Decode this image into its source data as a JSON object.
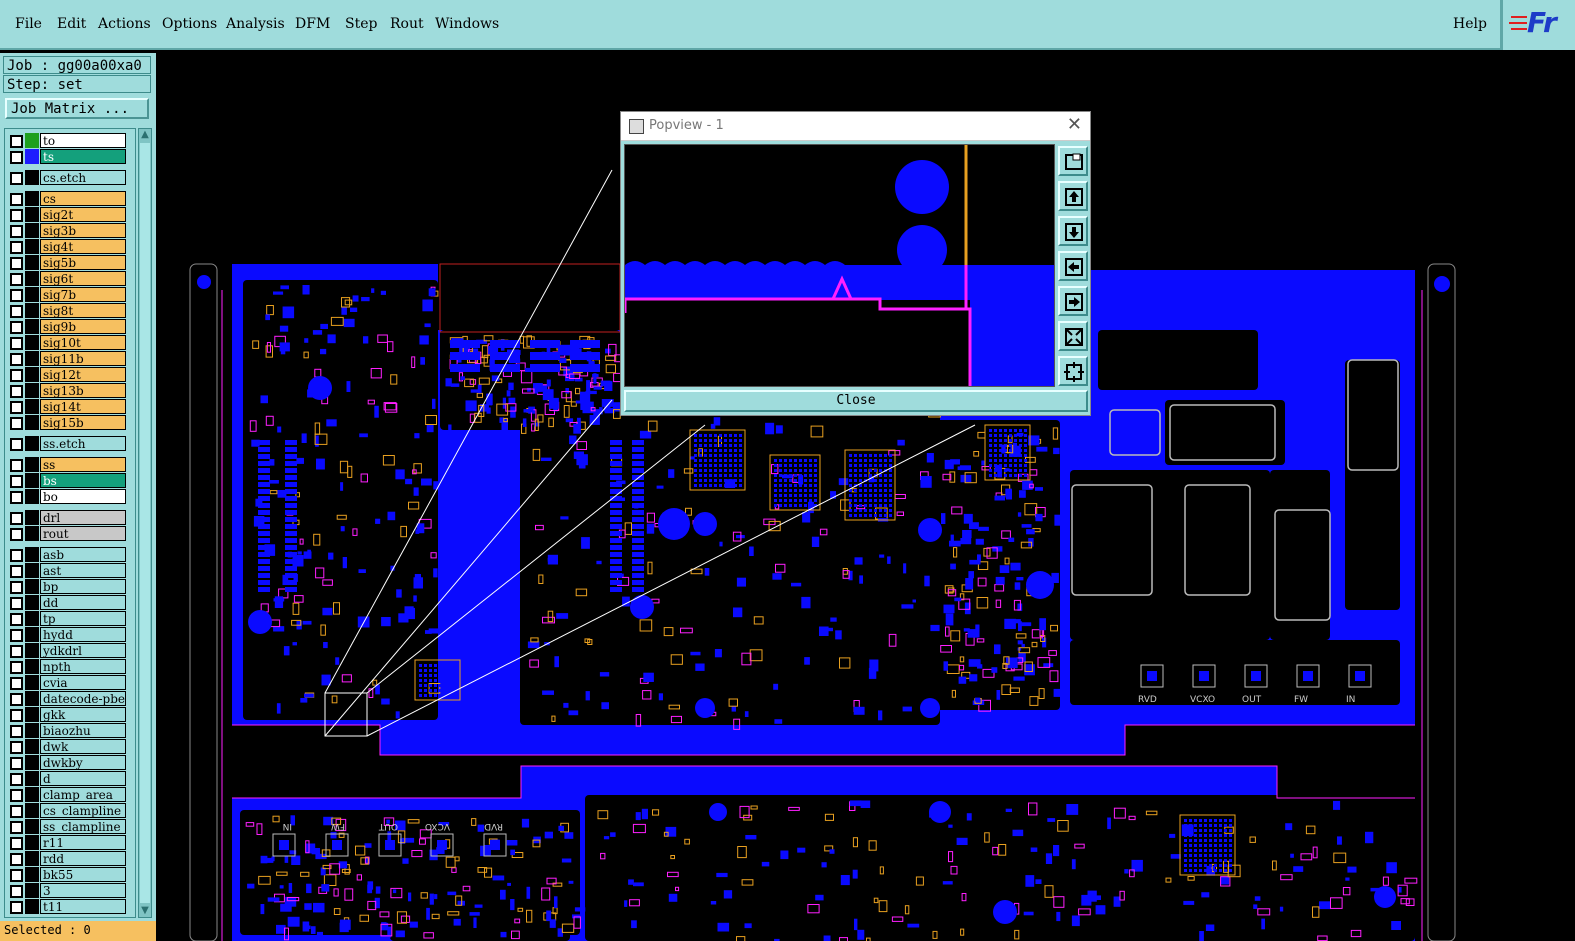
{
  "menu": {
    "items": [
      "File",
      "Edit",
      "Actions",
      "Options",
      "Analysis",
      "DFM",
      "Step",
      "Rout",
      "Windows"
    ],
    "help": "Help"
  },
  "logo": "Fr",
  "job_label": "Job : gg00a00xa0",
  "step_label": "Step: set",
  "job_matrix": "Job Matrix ...",
  "layers": [
    {
      "name": "to",
      "color": "#ffffff",
      "swatch": "#1ea01e"
    },
    {
      "name": "ts",
      "color": "#14a07c",
      "swatch": "#1d1dff"
    },
    {
      "name": "cs.etch",
      "color": "#9fdcdc",
      "swatch": "#000000"
    },
    {
      "name": "cs",
      "color": "#f6c060",
      "swatch": "#000000"
    },
    {
      "name": "sig2t",
      "color": "#f6c060",
      "swatch": "#000000"
    },
    {
      "name": "sig3b",
      "color": "#f6c060",
      "swatch": "#000000"
    },
    {
      "name": "sig4t",
      "color": "#f6c060",
      "swatch": "#000000"
    },
    {
      "name": "sig5b",
      "color": "#f6c060",
      "swatch": "#000000"
    },
    {
      "name": "sig6t",
      "color": "#f6c060",
      "swatch": "#000000"
    },
    {
      "name": "sig7b",
      "color": "#f6c060",
      "swatch": "#000000"
    },
    {
      "name": "sig8t",
      "color": "#f6c060",
      "swatch": "#000000"
    },
    {
      "name": "sig9b",
      "color": "#f6c060",
      "swatch": "#000000"
    },
    {
      "name": "sig10t",
      "color": "#f6c060",
      "swatch": "#000000"
    },
    {
      "name": "sig11b",
      "color": "#f6c060",
      "swatch": "#000000"
    },
    {
      "name": "sig12t",
      "color": "#f6c060",
      "swatch": "#000000"
    },
    {
      "name": "sig13b",
      "color": "#f6c060",
      "swatch": "#000000"
    },
    {
      "name": "sig14t",
      "color": "#f6c060",
      "swatch": "#000000"
    },
    {
      "name": "sig15b",
      "color": "#f6c060",
      "swatch": "#000000"
    },
    {
      "name": "ss.etch",
      "color": "#9fdcdc",
      "swatch": "#000000"
    },
    {
      "name": "ss",
      "color": "#f6c060",
      "swatch": "#000000"
    },
    {
      "name": "bs",
      "color": "#14a07c",
      "swatch": "#000000"
    },
    {
      "name": "bo",
      "color": "#ffffff",
      "swatch": "#000000"
    },
    {
      "name": "drl",
      "color": "#c8c8c8",
      "swatch": "#000000"
    },
    {
      "name": "rout",
      "color": "#c8c8c8",
      "swatch": "#000000"
    },
    {
      "name": "asb",
      "color": "#9fdcdc",
      "swatch": "#000000"
    },
    {
      "name": "ast",
      "color": "#9fdcdc",
      "swatch": "#000000"
    },
    {
      "name": "bp",
      "color": "#9fdcdc",
      "swatch": "#000000"
    },
    {
      "name": "dd",
      "color": "#9fdcdc",
      "swatch": "#000000"
    },
    {
      "name": "tp",
      "color": "#9fdcdc",
      "swatch": "#000000"
    },
    {
      "name": "hydd",
      "color": "#9fdcdc",
      "swatch": "#000000"
    },
    {
      "name": "ydkdrl",
      "color": "#9fdcdc",
      "swatch": "#000000"
    },
    {
      "name": "npth",
      "color": "#9fdcdc",
      "swatch": "#000000"
    },
    {
      "name": "cvia",
      "color": "#9fdcdc",
      "swatch": "#000000"
    },
    {
      "name": "datecode-pbe",
      "color": "#9fdcdc",
      "swatch": "#000000"
    },
    {
      "name": "gkk",
      "color": "#9fdcdc",
      "swatch": "#000000"
    },
    {
      "name": "biaozhu",
      "color": "#9fdcdc",
      "swatch": "#000000"
    },
    {
      "name": "dwk",
      "color": "#9fdcdc",
      "swatch": "#000000"
    },
    {
      "name": "dwkby",
      "color": "#9fdcdc",
      "swatch": "#000000"
    },
    {
      "name": "d",
      "color": "#9fdcdc",
      "swatch": "#000000"
    },
    {
      "name": "clamp_area",
      "color": "#9fdcdc",
      "swatch": "#000000"
    },
    {
      "name": "cs_clampline",
      "color": "#9fdcdc",
      "swatch": "#000000"
    },
    {
      "name": "ss_clampline",
      "color": "#9fdcdc",
      "swatch": "#000000"
    },
    {
      "name": "r11",
      "color": "#9fdcdc",
      "swatch": "#000000"
    },
    {
      "name": "rdd",
      "color": "#9fdcdc",
      "swatch": "#000000"
    },
    {
      "name": "bk55",
      "color": "#9fdcdc",
      "swatch": "#000000"
    },
    {
      "name": "3",
      "color": "#9fdcdc",
      "swatch": "#000000"
    },
    {
      "name": "t11",
      "color": "#9fdcdc",
      "swatch": "#000000"
    }
  ],
  "selected": "Selected : 0",
  "popview": {
    "title": "Popview - 1",
    "close": "Close",
    "tools": [
      "zoom-window-icon",
      "pan-up-icon",
      "pan-down-icon",
      "pan-left-icon",
      "pan-right-icon",
      "zoom-fit-icon",
      "zoom-home-icon"
    ]
  },
  "board_labels": {
    "top": [
      "RVD",
      "VCXO",
      "OUT",
      "FW",
      "IN"
    ],
    "bottom": [
      "IN",
      "FW",
      "OUT",
      "VCXO",
      "RVD"
    ]
  },
  "colors": {
    "panel": "#9fdcdc",
    "board": "#0a0aff",
    "copper": "#e8a020",
    "trace": "#ff20ff"
  }
}
